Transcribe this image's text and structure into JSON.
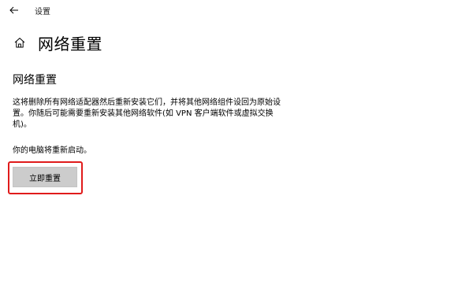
{
  "window": {
    "title": "设置"
  },
  "header": {
    "page_title": "网络重置"
  },
  "content": {
    "section_title": "网络重置",
    "description": "这将删除所有网络适配器然后重新安装它们，并将其他网络组件设回为原始设置。你随后可能需要重新安装其他网络软件(如 VPN 客户端软件或虚拟交换机)。",
    "restart_note": "你的电脑将重新启动。",
    "reset_button_label": "立即重置"
  },
  "icons": {
    "back": "back-arrow-icon",
    "home": "home-icon"
  },
  "colors": {
    "highlight_border": "#e01b1b",
    "button_bg": "#cccccc"
  }
}
